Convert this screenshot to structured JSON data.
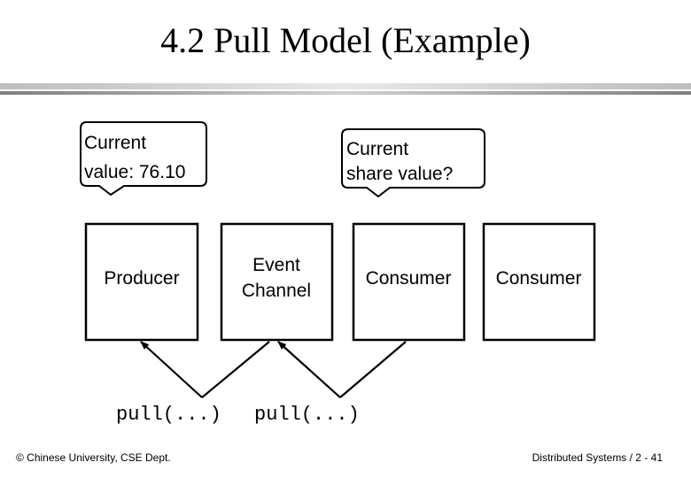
{
  "slide": {
    "title": "4.2 Pull Model (Example)"
  },
  "callouts": [
    {
      "line1": "Current",
      "line2": "value: 76.10"
    },
    {
      "line1": "Current",
      "line2": "share value?"
    }
  ],
  "boxes": [
    {
      "line1": "Producer",
      "line2": ""
    },
    {
      "line1": "Event",
      "line2": "Channel"
    },
    {
      "line1": "Consumer",
      "line2": ""
    },
    {
      "line1": "Consumer",
      "line2": ""
    }
  ],
  "calls": [
    {
      "label": "pull(...)"
    },
    {
      "label": "pull(...)"
    }
  ],
  "footer": {
    "left": "© Chinese University, CSE Dept.",
    "right": "Distributed Systems / 2 - 41"
  }
}
